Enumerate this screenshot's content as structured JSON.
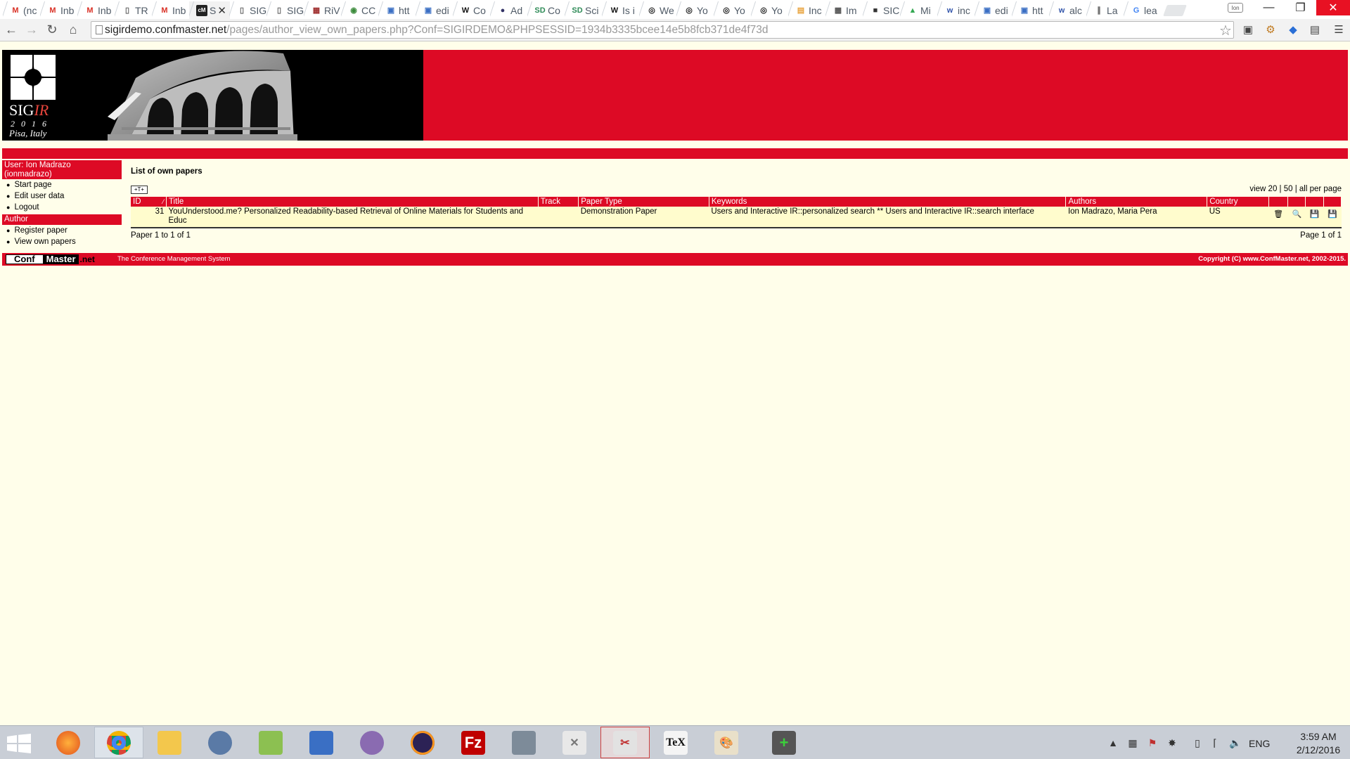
{
  "browser": {
    "tabs": [
      {
        "label": "(nc",
        "favicon": "gmail-icon",
        "color": "#d93025"
      },
      {
        "label": "Inb",
        "favicon": "gmail-icon",
        "color": "#d93025"
      },
      {
        "label": "Inb",
        "favicon": "gmail-icon",
        "color": "#d93025"
      },
      {
        "label": "TR",
        "favicon": "doc-icon",
        "color": "#666666"
      },
      {
        "label": "Inb",
        "favicon": "gmail-icon",
        "color": "#d93025"
      },
      {
        "label": "SIG",
        "favicon": "doc-icon",
        "color": "#666666"
      },
      {
        "label": "SIG",
        "favicon": "doc-icon",
        "color": "#666666"
      },
      {
        "label": "RiV",
        "favicon": "grid-icon",
        "color": "#a03030"
      },
      {
        "label": "CC",
        "favicon": "cc-icon",
        "color": "#3a8a3a"
      },
      {
        "label": "htt",
        "favicon": "page-icon",
        "color": "#3b6fc4"
      },
      {
        "label": "edi",
        "favicon": "page-icon",
        "color": "#3b6fc4"
      },
      {
        "label": "Co",
        "favicon": "w-icon",
        "color": "#111111"
      },
      {
        "label": "Ad",
        "favicon": "hal-icon",
        "color": "#333366"
      },
      {
        "label": "Co",
        "favicon": "sd-icon",
        "color": "#2e8b57"
      },
      {
        "label": "Sci",
        "favicon": "sd-icon",
        "color": "#2e8b57"
      },
      {
        "label": "Is i",
        "favicon": "w-icon",
        "color": "#111111"
      },
      {
        "label": "We",
        "favicon": "globe-icon",
        "color": "#222222"
      },
      {
        "label": "Yo",
        "favicon": "globe-icon",
        "color": "#222222"
      },
      {
        "label": "Yo",
        "favicon": "globe-icon",
        "color": "#222222"
      },
      {
        "label": "Yo",
        "favicon": "globe-icon",
        "color": "#222222"
      },
      {
        "label": "Inc",
        "favicon": "folder-icon",
        "color": "#e8a33c"
      },
      {
        "label": "Im",
        "favicon": "puzzle-icon",
        "color": "#555555"
      },
      {
        "label": "SIC",
        "favicon": "cm-icon",
        "color": "#333333"
      },
      {
        "label": "Mi",
        "favicon": "maps-icon",
        "color": "#34a853"
      },
      {
        "label": "inc",
        "favicon": "wr-icon",
        "color": "#3355aa"
      },
      {
        "label": "edi",
        "favicon": "page-icon",
        "color": "#3b6fc4"
      },
      {
        "label": "htt",
        "favicon": "page-icon",
        "color": "#3b6fc4"
      },
      {
        "label": "alc",
        "favicon": "wr-icon",
        "color": "#3355aa"
      },
      {
        "label": "La",
        "favicon": "latex-icon",
        "color": "#555555"
      },
      {
        "label": "lea",
        "favicon": "google-icon",
        "color": "#4285f4"
      }
    ],
    "active_tab": {
      "label": "S",
      "favicon": "cm-icon"
    },
    "url_domain": "sigirdemo.confmaster.net",
    "url_path": "/pages/author_view_own_papers.php?Conf=SIGIRDEMO&PHPSESSID=1934b3335bcee14e5b8fcb371de4f73d"
  },
  "banner": {
    "logo_sig": "SIG",
    "logo_ir": "IR",
    "logo_year": "2016",
    "logo_place": "Pisa, Italy",
    "accent": "#dd0a25"
  },
  "sidebar": {
    "user_header": "User: Ion Madrazo (ionmadrazo)",
    "user_items": [
      "Start page",
      "Edit user data",
      "Logout"
    ],
    "author_header": "Author",
    "author_items": [
      "Register paper",
      "View own papers"
    ]
  },
  "main": {
    "title": "List of own papers",
    "view_per_page": "view 20 | 50 | all per page",
    "columns": {
      "id": "ID",
      "title": "Title",
      "track": "Track",
      "paper_type": "Paper Type",
      "keywords": "Keywords",
      "authors": "Authors",
      "country": "Country"
    },
    "rows": [
      {
        "id": "31",
        "title": "YouUnderstood.me? Personalized Readability-based Retrieval of Online Materials for Students and Educ",
        "track": "",
        "paper_type": "Demonstration Paper",
        "keywords": "Users and Interactive IR::personalized search ** Users and Interactive IR::search interface",
        "authors": "Ion Madrazo, Maria Pera",
        "country": "US"
      }
    ],
    "paper_range": "Paper 1 to 1 of 1",
    "page_number": "Page 1 of 1"
  },
  "footer": {
    "logo_conf": "Conf",
    "logo_master": "Master",
    "logo_net": ".net",
    "tagline": "The Conference Management System",
    "copyright": "Copyright (C) www.ConfMaster.net, 2002-2015."
  },
  "taskbar": {
    "lang": "ENG",
    "time": "3:59 AM",
    "date": "2/12/2016"
  }
}
